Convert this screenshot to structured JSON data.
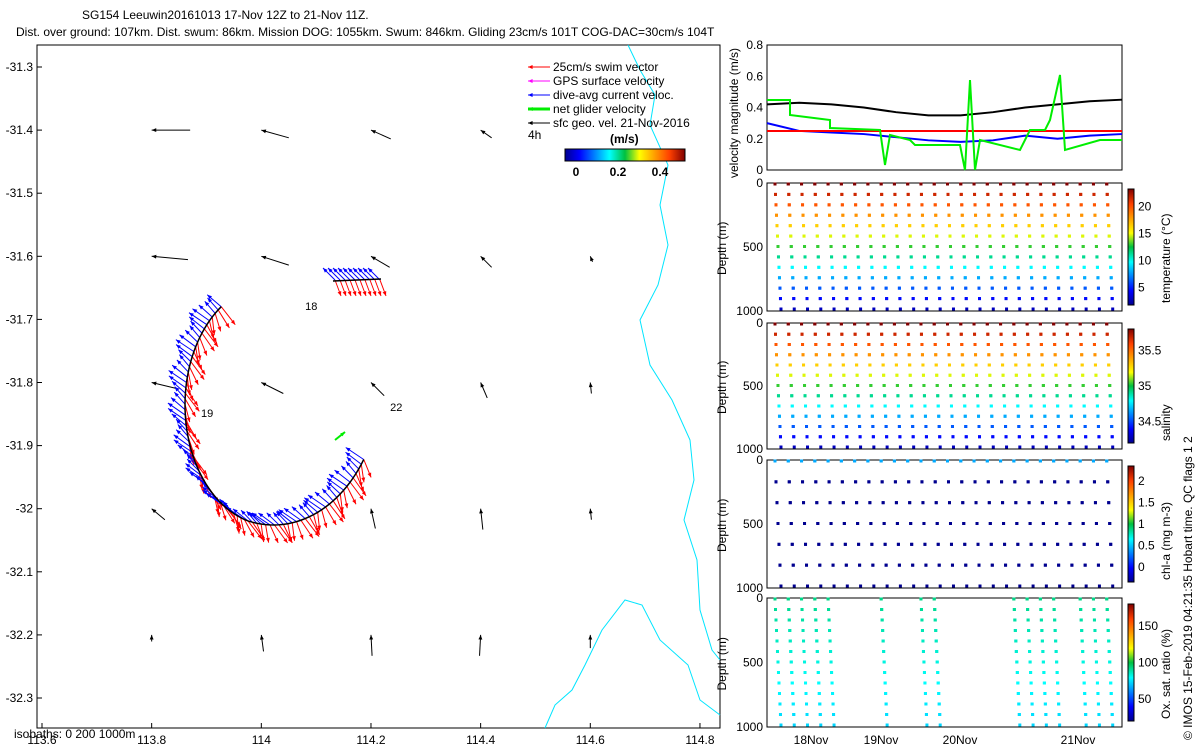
{
  "title": {
    "line1": "SG154 Leeuwin20161013 17-Nov 12Z to 21-Nov 11Z.",
    "line2": "Dist. over ground: 107km. Dist. swum: 86km. Mission DOG: 1055km. Swum: 846km. Gliding 23cm/s 101T COG-DAC=30cm/s 104T"
  },
  "colors": {
    "swim": "#ff0000",
    "gps": "#ff00ff",
    "dac": "#0000ff",
    "net": "#00ee00",
    "geo": "#000000",
    "coast": "#00e5ff"
  },
  "chart_data": [
    {
      "type": "scatter",
      "name": "map",
      "xlim": [
        113.59,
        114.85
      ],
      "ylim": [
        -32.35,
        -31.25
      ],
      "xticks": [
        "113.6",
        "113.8",
        "114",
        "114.2",
        "114.4",
        "114.6",
        "114.8"
      ],
      "yticks": [
        "-31.3",
        "-31.4",
        "-31.5",
        "-31.6",
        "-31.7",
        "-31.8",
        "-31.9",
        "-32",
        "-32.1",
        "-32.2",
        "-32.3"
      ],
      "legend": [
        "25cm/s swim vector",
        "GPS surface velocity",
        "dive-avg current veloc.",
        "net glider velocity",
        "sfc geo. vel. 21-Nov-2016"
      ],
      "legend_extra": "4h",
      "colorbar": {
        "label": "(m/s)",
        "ticks": [
          "0",
          "0.2",
          "0.4"
        ]
      },
      "isobaths": "isobaths: 0   200  1000m",
      "track_labels": [
        {
          "text": "18",
          "lon": 114.08,
          "lat": -31.685
        },
        {
          "text": "19",
          "lon": 113.89,
          "lat": -31.855
        },
        {
          "text": "22",
          "lon": 114.235,
          "lat": -31.845
        }
      ],
      "geo_vectors": [
        {
          "lon": 113.8,
          "lat": -31.4,
          "u": -0.35,
          "v": 0
        },
        {
          "lon": 114,
          "lat": -31.4,
          "u": -0.25,
          "v": 0.07
        },
        {
          "lon": 114.2,
          "lat": -31.4,
          "u": -0.18,
          "v": 0.08
        },
        {
          "lon": 114.4,
          "lat": -31.4,
          "u": -0.1,
          "v": 0.07
        },
        {
          "lon": 113.8,
          "lat": -31.6,
          "u": -0.33,
          "v": 0.03
        },
        {
          "lon": 114,
          "lat": -31.6,
          "u": -0.25,
          "v": 0.08
        },
        {
          "lon": 114.2,
          "lat": -31.6,
          "u": -0.17,
          "v": 0.1
        },
        {
          "lon": 114.4,
          "lat": -31.6,
          "u": -0.1,
          "v": 0.1
        },
        {
          "lon": 114.6,
          "lat": -31.6,
          "u": -0.02,
          "v": 0.05
        },
        {
          "lon": 113.8,
          "lat": -31.8,
          "u": -0.25,
          "v": 0.06
        },
        {
          "lon": 114,
          "lat": -31.8,
          "u": -0.2,
          "v": 0.1
        },
        {
          "lon": 114.2,
          "lat": -31.8,
          "u": -0.12,
          "v": 0.12
        },
        {
          "lon": 114.4,
          "lat": -31.8,
          "u": -0.06,
          "v": 0.14
        },
        {
          "lon": 114.6,
          "lat": -31.8,
          "u": -0.01,
          "v": 0.1
        },
        {
          "lon": 113.8,
          "lat": -32,
          "u": -0.12,
          "v": 0.1
        },
        {
          "lon": 114.2,
          "lat": -32,
          "u": -0.04,
          "v": 0.18
        },
        {
          "lon": 114.4,
          "lat": -32,
          "u": -0.02,
          "v": 0.19
        },
        {
          "lon": 114.6,
          "lat": -32,
          "u": -0.01,
          "v": 0.1
        },
        {
          "lon": 114,
          "lat": -32.2,
          "u": -0.02,
          "v": 0.15
        },
        {
          "lon": 114.2,
          "lat": -32.2,
          "u": -0.01,
          "v": 0.19
        },
        {
          "lon": 114.4,
          "lat": -32.2,
          "u": 0.01,
          "v": 0.19
        },
        {
          "lon": 114.6,
          "lat": -32.2,
          "u": 0,
          "v": 0.12
        },
        {
          "lon": 113.8,
          "lat": -32.2,
          "u": 0,
          "v": 0.06
        }
      ]
    },
    {
      "type": "line",
      "name": "velocity",
      "ylabel": "velocity magnitude (m/s)",
      "ylim": [
        0,
        0.8
      ],
      "yticks": [
        "0",
        "0.2",
        "0.4",
        "0.6",
        "0.8"
      ],
      "series": [
        {
          "name": "net",
          "values": [
            0.42,
            0.43,
            0.42,
            0.4,
            0.37,
            0.35,
            0.35,
            0.37,
            0.4,
            0.42,
            0.44,
            0.45
          ]
        },
        {
          "name": "dac",
          "values": [
            0.3,
            0.25,
            0.24,
            0.23,
            0.21,
            0.19,
            0.18,
            0.19,
            0.22,
            0.2,
            0.22,
            0.23
          ]
        },
        {
          "name": "swim",
          "values": [
            0.25,
            0.25,
            0.25,
            0.25,
            0.25,
            0.25,
            0.25,
            0.25,
            0.25,
            0.25,
            0.25,
            0.25
          ]
        }
      ]
    },
    {
      "type": "scatter",
      "name": "sections",
      "xticks": [
        "18Nov",
        "19Nov",
        "20Nov",
        "21Nov"
      ],
      "ylabel": "Depth (m)",
      "yticks": [
        "0",
        "500",
        "1000"
      ],
      "panels": [
        {
          "label": "temperature (°C)",
          "ticks": [
            "5",
            "10",
            "15",
            "20"
          ],
          "dives": 26,
          "maxdepth": 1000
        },
        {
          "label": "salinity",
          "ticks": [
            "34.5",
            "35",
            "35.5"
          ],
          "dives": 26,
          "maxdepth": 1000
        },
        {
          "label": "chl-a (mg m-3)",
          "ticks": [
            "0",
            "0.5",
            "1",
            "1.5",
            "2"
          ],
          "dives": 26,
          "maxdepth": 1000
        },
        {
          "label": "Ox. sat. ratio (%)",
          "ticks": [
            "50",
            "100",
            "150"
          ],
          "dives": 14,
          "maxdepth": 1000
        }
      ]
    }
  ],
  "footer": "© IMOS 15-Feb-2019 04:21:35 Hobart time. QC flags 1  2"
}
